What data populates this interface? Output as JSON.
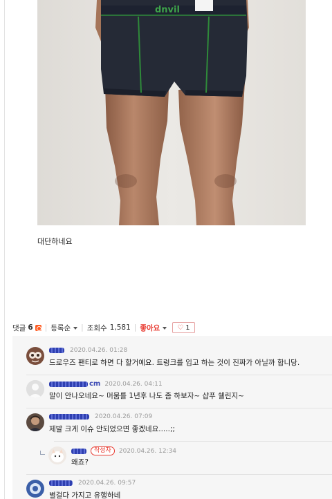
{
  "post": {
    "text": "대단하네요"
  },
  "photo": {
    "waistband_text": "dnvil"
  },
  "meta": {
    "comments_label": "댓글",
    "comments_count": "6",
    "sort_label": "등록순",
    "views_label": "조회수",
    "views_count": "1,581",
    "like_label": "좋아요",
    "like_count": "1"
  },
  "comments": [
    {
      "name": "",
      "date": "2020.04.26. 01:28",
      "text": "드로우즈 팬티로 하면 다 할거예요. 트렁크를 입고 하는 것이 진짜가 아닐까 합니당.",
      "avatar": "avatar-1"
    },
    {
      "name": "cm",
      "date": "2020.04.26. 04:11",
      "text": "말이 안나오네요~ 머뭄를 1년후 나도 좀 하보자~ 샵푸 쉘린지~",
      "avatar": "avatar-default"
    },
    {
      "name": "",
      "date": "2020.04.26. 07:09",
      "text": "제발 크게 이슈 안되었으면 좋겠네요.....;;",
      "avatar": "avatar-3"
    },
    {
      "name": "",
      "author_tag": "작성자",
      "date": "2020.04.26. 12:34",
      "text": "왜죠?",
      "avatar": "avatar-cat",
      "is_reply": true
    },
    {
      "name": "",
      "date": "2020.04.26. 09:57",
      "text": "별걸다 가지고 유행하네",
      "avatar": "avatar-5"
    }
  ]
}
